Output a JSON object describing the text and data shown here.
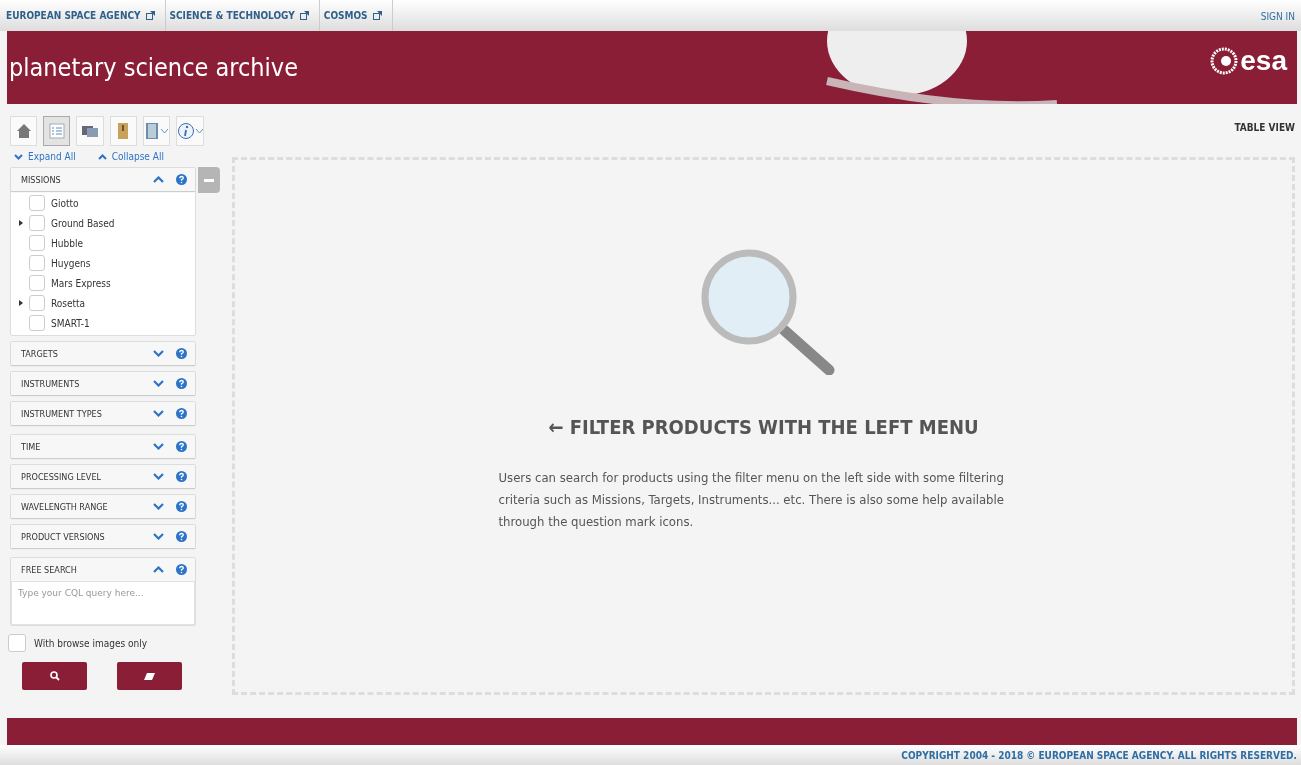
{
  "top_nav": {
    "links": [
      {
        "label": "EUROPEAN SPACE AGENCY"
      },
      {
        "label": "SCIENCE & TECHNOLOGY"
      },
      {
        "label": "COSMOS"
      }
    ],
    "sign_in": "SIGN IN"
  },
  "header": {
    "title": "planetary science archive",
    "logo": "esa"
  },
  "toolbar": {
    "buttons": [
      {
        "kind": "home",
        "selected": false,
        "dropdown": false
      },
      {
        "kind": "list",
        "selected": true,
        "dropdown": false
      },
      {
        "kind": "images",
        "selected": false,
        "dropdown": false
      },
      {
        "kind": "archive",
        "selected": false,
        "dropdown": false
      },
      {
        "kind": "book",
        "selected": false,
        "dropdown": true
      },
      {
        "kind": "info",
        "selected": false,
        "dropdown": true
      }
    ]
  },
  "expand_all": "Expand All",
  "collapse_all": "Collapse All",
  "view_label": "TABLE VIEW",
  "filter_groups": [
    {
      "sections": [
        {
          "title": "MISSIONS",
          "expanded": true,
          "kind": "list",
          "items": [
            {
              "label": "Giotto",
              "checked": false,
              "has_children": false
            },
            {
              "label": "Ground Based",
              "checked": false,
              "has_children": true
            },
            {
              "label": "Hubble",
              "checked": false,
              "has_children": false
            },
            {
              "label": "Huygens",
              "checked": false,
              "has_children": false
            },
            {
              "label": "Mars Express",
              "checked": false,
              "has_children": false
            },
            {
              "label": "Rosetta",
              "checked": false,
              "has_children": true
            },
            {
              "label": "SMART-1",
              "checked": false,
              "has_children": false
            }
          ]
        },
        {
          "title": "TARGETS",
          "expanded": false
        },
        {
          "title": "INSTRUMENTS",
          "expanded": false
        },
        {
          "title": "INSTRUMENT TYPES",
          "expanded": false
        }
      ]
    },
    {
      "sections": [
        {
          "title": "TIME",
          "expanded": false
        },
        {
          "title": "PROCESSING LEVEL",
          "expanded": false
        },
        {
          "title": "WAVELENGTH RANGE",
          "expanded": false
        },
        {
          "title": "PRODUCT VERSIONS",
          "expanded": false
        }
      ]
    },
    {
      "sections": [
        {
          "title": "FREE SEARCH",
          "expanded": true,
          "kind": "query",
          "placeholder": "Type your CQL query here..."
        }
      ]
    }
  ],
  "browse_only": {
    "label": "With browse images only",
    "checked": false
  },
  "empty_state": {
    "arrow": "←",
    "heading": "FILTER PRODUCTS WITH THE LEFT MENU",
    "text": "Users can search for products using the filter menu on the left side with some filtering criteria such as Missions, Targets, Instruments... etc. There is also some help available through the question mark icons."
  },
  "copyright": "COPYRIGHT 2004 - 2018 © EUROPEAN SPACE AGENCY. ALL RIGHTS RESERVED."
}
